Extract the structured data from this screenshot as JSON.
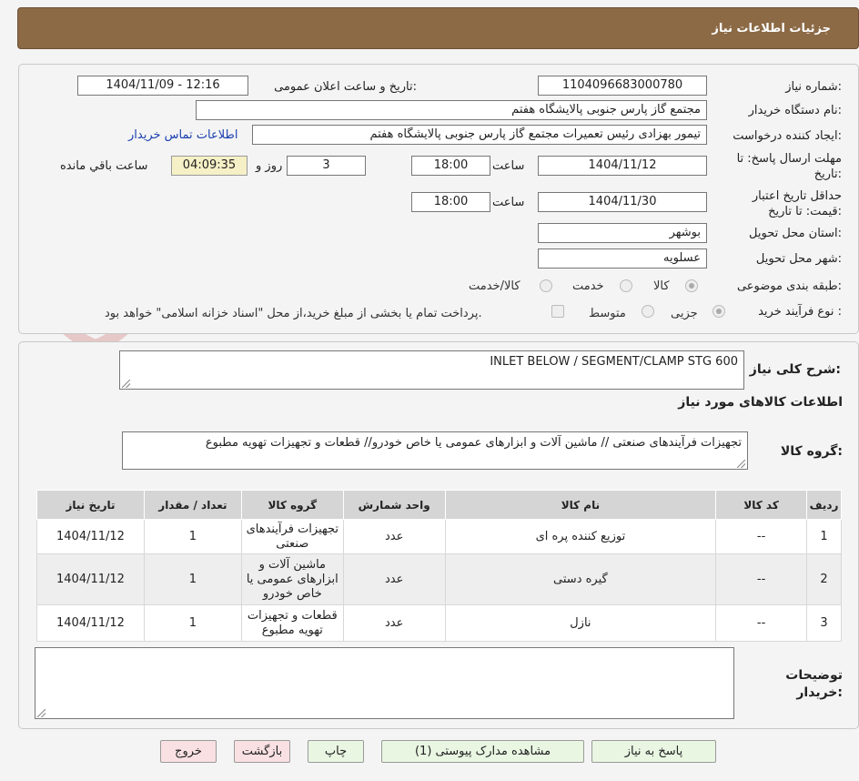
{
  "header": {
    "title": "جزئیات اطلاعات نیاز"
  },
  "watermark": {
    "text": "AriaTender.neT"
  },
  "form": {
    "need_number_label": "شماره نیاز:",
    "need_number": "1104096683000780",
    "announce_label": "تاریخ و ساعت اعلان عمومی:",
    "announce_value": "1404/11/09 - 12:16",
    "buyer_org_label": "نام دستگاه خریدار:",
    "buyer_org": "مجتمع گاز پارس جنوبی  پالایشگاه هفتم",
    "creator_label": "ایجاد کننده درخواست:",
    "creator": "تیمور بهزادی رئیس تعمیرات مجتمع گاز پارس جنوبی  پالایشگاه هفتم",
    "contact_link": "اطلاعات تماس خریدار",
    "deadline_label": "مهلت ارسال پاسخ: تا تاریخ:",
    "deadline_date": "1404/11/12",
    "time_label": "ساعت",
    "deadline_time": "18:00",
    "days_value": "3",
    "days_label": "روز و",
    "remaining_time": "04:09:35",
    "remaining_label": "ساعت باقي مانده",
    "validity_label": "حداقل تاریخ اعتبار قیمت: تا تاریخ:",
    "validity_date": "1404/11/30",
    "validity_time": "18:00",
    "province_label": "استان محل تحویل:",
    "province": "بوشهر",
    "city_label": "شهر محل تحویل:",
    "city": "عسلویه",
    "category_label": "طبقه بندی موضوعی:",
    "category_options": [
      "کالا",
      "خدمت",
      "کالا/خدمت"
    ],
    "process_label": "نوع فرآیند خرید :",
    "process_options": [
      "جزیی",
      "متوسط"
    ],
    "payment_note": "پرداخت تمام یا بخشی از مبلغ خرید،از محل \"اسناد خزانه اسلامی\" خواهد بود."
  },
  "summary": {
    "description_label": "شرح کلی نیاز:",
    "description": "INLET BELOW / SEGMENT/CLAMP STG 600",
    "goods_info_title": "اطلاعات کالاهای مورد نیاز",
    "goods_group_label": "گروه کالا:",
    "goods_group": "تجهیزات فرآیندهای صنعتی //  ماشین آلات و ابزارهای عمومی یا خاص خودرو//  قطعات و تجهیزات تهویه مطبوع"
  },
  "table": {
    "headers": [
      "ردیف",
      "کد کالا",
      "نام کالا",
      "واحد شمارش",
      "گروه کالا",
      "تعداد / مقدار",
      "تاریخ نیاز"
    ],
    "rows": [
      [
        "1",
        "--",
        "توزیع کننده پره ای",
        "عدد",
        "تجهیزات فرآیندهای صنعتی",
        "1",
        "1404/11/12"
      ],
      [
        "2",
        "--",
        "گیره دستی",
        "عدد",
        "ماشین آلات و ابزارهای عمومی یا خاص خودرو",
        "1",
        "1404/11/12"
      ],
      [
        "3",
        "--",
        "نازل",
        "عدد",
        "قطعات و تجهیزات تهویه مطبوع",
        "1",
        "1404/11/12"
      ]
    ]
  },
  "notes": {
    "label": "توضیحات خریدار:",
    "value": ""
  },
  "buttons": {
    "reply": "پاسخ به نیاز",
    "attachments": "مشاهده مدارک پیوستی (1)",
    "print": "چاپ",
    "back": "بازگشت",
    "exit": "خروج"
  },
  "colors": {
    "header_bg": "#8c6a46",
    "link": "#1a3fb0",
    "timer_bg": "#f6f0c6",
    "green_btn": "#e9f6e2",
    "pink_btn": "#f9e0e3"
  }
}
